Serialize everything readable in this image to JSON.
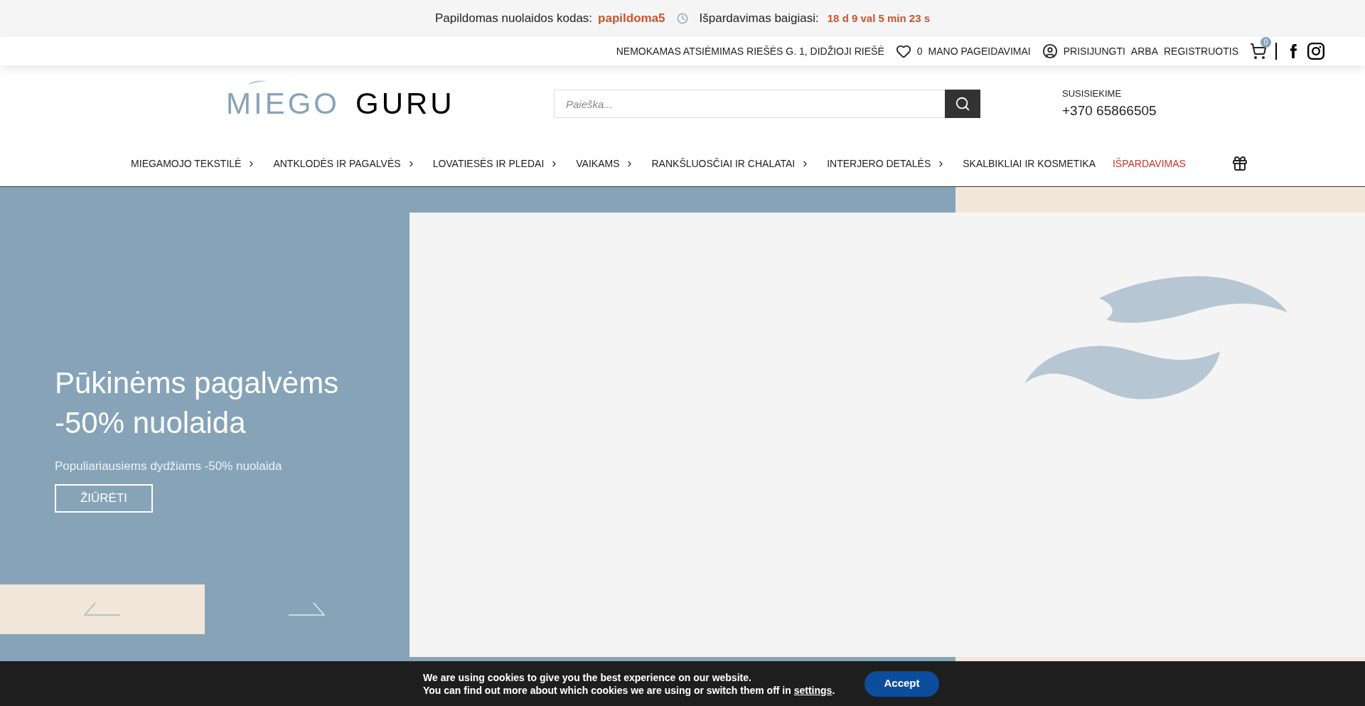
{
  "promo_bar": {
    "code_label": "Papildomas nuolaidos kodas:",
    "code": "papildoma5",
    "countdown_label": "Išpardavimas baigiasi:",
    "countdown": "18 d 9 val 5 min 23 s"
  },
  "utility_bar": {
    "pickup": "NEMOKAMAS ATSIĖMIMAS RIEŠĖS G. 1, DIDŽIOJI RIEŠĖ",
    "wishlist_count": "0",
    "wishlist": "MANO PAGEIDAVIMAI",
    "login": "PRISIJUNGTI",
    "or": "ARBA",
    "register": "REGISTRUOTIS",
    "cart_count": "0"
  },
  "header": {
    "logo_first": "MIEGO",
    "logo_second": "GURU",
    "search": {
      "placeholder": "Paieška..."
    },
    "contact_label": "SUSISIEKIME",
    "phone": "+370 65866505"
  },
  "nav": [
    {
      "label": "MIEGAMOJO TEKSTILĖ",
      "has_dropdown": true,
      "highlighted": false
    },
    {
      "label": "ANTKLODĖS IR PAGALVĖS",
      "has_dropdown": true,
      "highlighted": false
    },
    {
      "label": "LOVATIESĖS IR PLEDAI",
      "has_dropdown": true,
      "highlighted": false
    },
    {
      "label": "VAIKAMS",
      "has_dropdown": true,
      "highlighted": false
    },
    {
      "label": "RANKŠLUOSČIAI IR CHALATAI",
      "has_dropdown": true,
      "highlighted": false
    },
    {
      "label": "INTERJERO DETALĖS",
      "has_dropdown": true,
      "highlighted": false
    },
    {
      "label": "SKALBIKLIAI IR KOSMETIKA",
      "has_dropdown": false,
      "highlighted": false
    },
    {
      "label": "IŠPARDAVIMAS",
      "has_dropdown": false,
      "highlighted": true
    }
  ],
  "hero": {
    "title_lines": [
      "Pūkinėms pagalvėms",
      "-50% nuolaida"
    ],
    "subtitle": "Populiariausiems dydžiams -50% nuolaida",
    "button": "ŽIŪRĖTI"
  },
  "cookie_bar": {
    "line1": "We are using cookies to give you the best experience on our website.",
    "line2_before": "You can find out more about which cookies we are using or switch them off in",
    "link": "settings",
    "line2_after": ".",
    "button": "Accept"
  }
}
